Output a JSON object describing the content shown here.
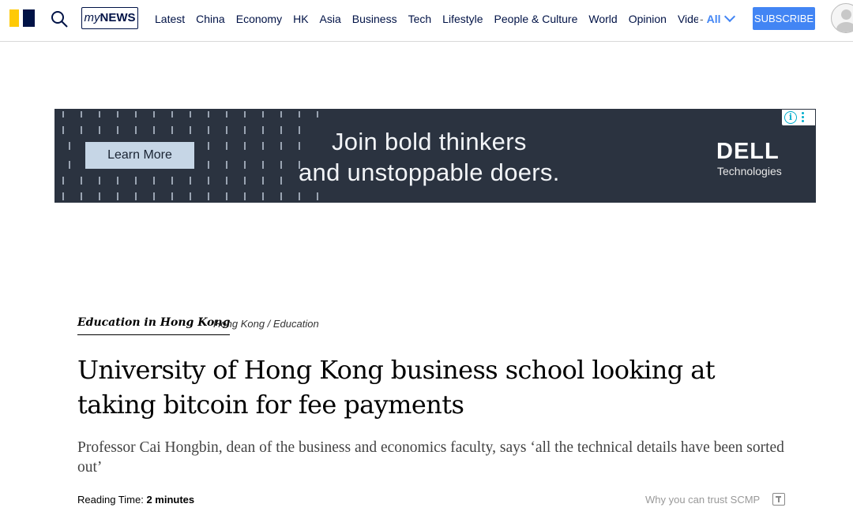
{
  "header": {
    "mynews_prefix": "my",
    "mynews_suffix": "NEWS",
    "nav": [
      "Latest",
      "China",
      "Economy",
      "HK",
      "Asia",
      "Business",
      "Tech",
      "Lifestyle",
      "People & Culture",
      "World",
      "Opinion",
      "Vide"
    ],
    "all_dash": "-",
    "all_label": "All",
    "subscribe_label": "SUBSCRIBE",
    "colors": {
      "navy": "#001246",
      "yellow": "#FFCA05",
      "accent": "#4285F4"
    }
  },
  "ad": {
    "button_label": "Learn More",
    "headline_line1": "Join bold thinkers",
    "headline_line2": "and unstoppable doers.",
    "brand_word": "DELL",
    "brand_sub": "Technologies",
    "info_icon": "i"
  },
  "article": {
    "topic": "Education in Hong Kong",
    "section": "Hong Kong / Education",
    "headline": "University of Hong Kong business school looking at taking bitcoin for fee payments",
    "summary": "Professor Cai Hongbin, dean of the business and economics faculty, says ‘all the technical details have been sorted out’",
    "reading_time_label": "Reading Time:",
    "reading_time_value": "2 minutes",
    "trust_label": "Why you can trust SCMP"
  }
}
